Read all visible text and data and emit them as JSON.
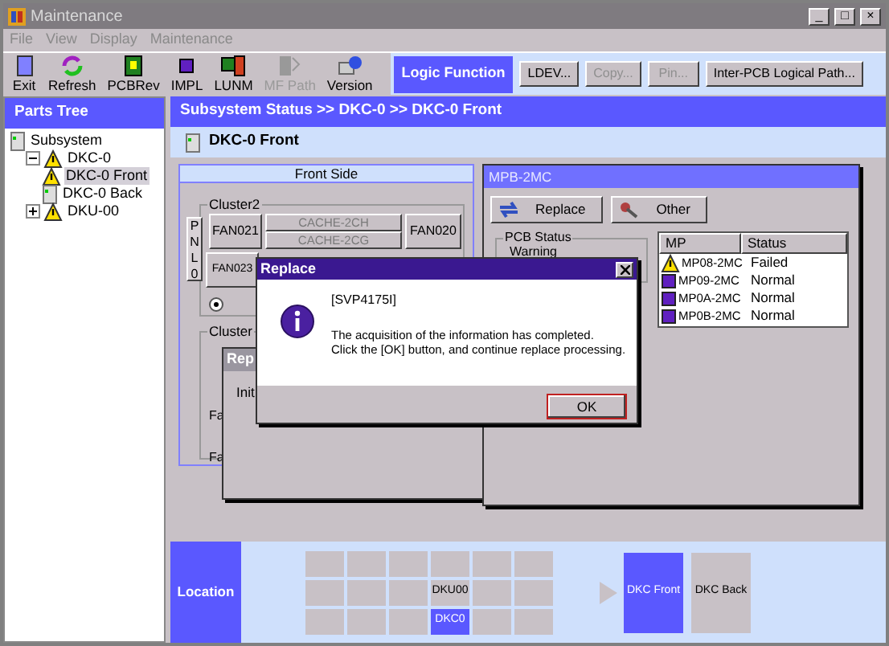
{
  "window": {
    "title": "Maintenance",
    "controls": [
      "_",
      "□",
      "×"
    ]
  },
  "menu": [
    {
      "label": "File",
      "disabled": true
    },
    {
      "label": "View",
      "disabled": true
    },
    {
      "label": "Display",
      "disabled": true
    },
    {
      "label": "Maintenance",
      "disabled": true
    }
  ],
  "toolbar": [
    {
      "label": "Exit",
      "disabled": false
    },
    {
      "label": "Refresh",
      "disabled": false
    },
    {
      "label": "PCBRev",
      "disabled": false
    },
    {
      "label": "IMPL",
      "disabled": false
    },
    {
      "label": "LUNM",
      "disabled": false
    },
    {
      "label": "MF Path",
      "disabled": true
    },
    {
      "label": "Version",
      "disabled": false
    }
  ],
  "logic_function": {
    "title": "Logic Function",
    "buttons": [
      {
        "label": "LDEV...",
        "disabled": false
      },
      {
        "label": "Copy...",
        "disabled": true
      },
      {
        "label": "Pin...",
        "disabled": true
      },
      {
        "label": "Inter-PCB Logical Path...",
        "disabled": false
      }
    ]
  },
  "parts_tree": {
    "title": "Parts Tree",
    "items": [
      {
        "label": "Subsystem",
        "warning": false,
        "selected": false,
        "children": [
          {
            "label": "DKC-0",
            "warning": true,
            "selected": false,
            "expanded": true,
            "children": [
              {
                "label": "DKC-0 Front",
                "warning": true,
                "selected": true
              },
              {
                "label": "DKC-0 Back",
                "warning": false,
                "selected": false
              }
            ]
          },
          {
            "label": "DKU-00",
            "warning": true,
            "selected": false,
            "expanded": false
          }
        ]
      }
    ]
  },
  "breadcrumb": "Subsystem Status >> DKC-0 >> DKC-0 Front",
  "page_title": "DKC-0 Front",
  "front_side": {
    "title": "Front Side",
    "cluster_upper": "Cluster2",
    "panel": "PNL0",
    "fans": [
      "FAN021",
      "FAN020",
      "FAN023"
    ],
    "caches": [
      {
        "label": "CACHE-2CH",
        "disabled": true
      },
      {
        "label": "CACHE-2CG",
        "disabled": true
      }
    ],
    "radio_checked": true,
    "cluster_lower": "Cluster",
    "lower_items": [
      "Fa",
      "Fa"
    ]
  },
  "background_dialog": {
    "title": "Rep",
    "text": "Init"
  },
  "mpb_window": {
    "title": "MPB-2MC",
    "buttons": [
      "Replace",
      "Other"
    ],
    "pcb_status": {
      "label": "PCB Status",
      "value": "Warning"
    },
    "table": {
      "columns": [
        "MP",
        "Status"
      ],
      "rows": [
        {
          "mp": "MP08-2MC",
          "status": "Failed",
          "warning": true
        },
        {
          "mp": "MP09-2MC",
          "status": "Normal",
          "warning": false
        },
        {
          "mp": "MP0A-2MC",
          "status": "Normal",
          "warning": false
        },
        {
          "mp": "MP0B-2MC",
          "status": "Normal",
          "warning": false
        }
      ]
    }
  },
  "dialog": {
    "title": "Replace",
    "code": "[SVP4175I]",
    "message": [
      "The acquisition of the information has completed.",
      "Click the [OK] button, and continue replace processing."
    ],
    "button": "OK"
  },
  "location": {
    "label": "Location",
    "grid": [
      [
        {
          "selected": false
        },
        {
          "selected": false
        },
        {
          "selected": false
        },
        {
          "selected": false
        },
        {
          "selected": false
        },
        {
          "selected": false
        }
      ],
      [
        {
          "selected": false
        },
        {
          "selected": false
        },
        {
          "selected": false
        },
        {
          "label": "DKU00",
          "selected": false
        },
        {
          "selected": false
        },
        {
          "selected": false
        }
      ],
      [
        {
          "selected": false
        },
        {
          "selected": false
        },
        {
          "selected": false
        },
        {
          "label": "DKC0",
          "selected": true
        },
        {
          "selected": false
        },
        {
          "selected": false
        }
      ]
    ],
    "views": [
      {
        "label": "DKC Front",
        "selected": true
      },
      {
        "label": "DKC Back",
        "selected": false
      }
    ]
  }
}
